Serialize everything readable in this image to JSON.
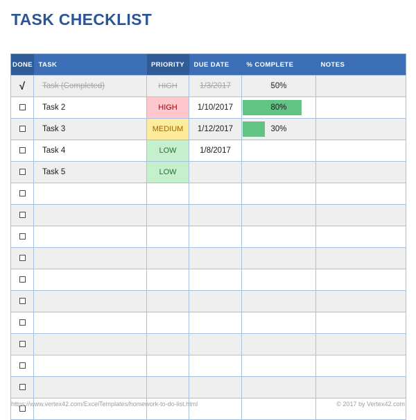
{
  "title": "TASK CHECKLIST",
  "table": {
    "columns": [
      {
        "key": "done",
        "label": "DONE"
      },
      {
        "key": "task",
        "label": "TASK"
      },
      {
        "key": "priority",
        "label": "PRIORITY"
      },
      {
        "key": "due",
        "label": "DUE DATE"
      },
      {
        "key": "pct",
        "label": "% COMPLETE"
      },
      {
        "key": "notes",
        "label": "NOTES"
      }
    ],
    "check_glyph": "√",
    "rows": [
      {
        "done": true,
        "task": "Task (Completed)",
        "priority": "HIGH",
        "due": "1/3/2017",
        "pct": "50%",
        "pct_value": 50,
        "notes": "",
        "completed": true,
        "bar": false
      },
      {
        "done": false,
        "task": "Task 2",
        "priority": "HIGH",
        "due": "1/10/2017",
        "pct": "80%",
        "pct_value": 80,
        "notes": "",
        "completed": false,
        "bar": true
      },
      {
        "done": false,
        "task": "Task 3",
        "priority": "MEDIUM",
        "due": "1/12/2017",
        "pct": "30%",
        "pct_value": 30,
        "notes": "",
        "completed": false,
        "bar": true
      },
      {
        "done": false,
        "task": "Task 4",
        "priority": "LOW",
        "due": "1/8/2017",
        "pct": "",
        "pct_value": 0,
        "notes": "",
        "completed": false,
        "bar": false
      },
      {
        "done": false,
        "task": "Task 5",
        "priority": "LOW",
        "due": "",
        "pct": "",
        "pct_value": 0,
        "notes": "",
        "completed": false,
        "bar": false
      },
      {
        "done": false,
        "task": "",
        "priority": "",
        "due": "",
        "pct": "",
        "pct_value": 0,
        "notes": "",
        "completed": false,
        "bar": false
      },
      {
        "done": false,
        "task": "",
        "priority": "",
        "due": "",
        "pct": "",
        "pct_value": 0,
        "notes": "",
        "completed": false,
        "bar": false
      },
      {
        "done": false,
        "task": "",
        "priority": "",
        "due": "",
        "pct": "",
        "pct_value": 0,
        "notes": "",
        "completed": false,
        "bar": false
      },
      {
        "done": false,
        "task": "",
        "priority": "",
        "due": "",
        "pct": "",
        "pct_value": 0,
        "notes": "",
        "completed": false,
        "bar": false
      },
      {
        "done": false,
        "task": "",
        "priority": "",
        "due": "",
        "pct": "",
        "pct_value": 0,
        "notes": "",
        "completed": false,
        "bar": false
      },
      {
        "done": false,
        "task": "",
        "priority": "",
        "due": "",
        "pct": "",
        "pct_value": 0,
        "notes": "",
        "completed": false,
        "bar": false
      },
      {
        "done": false,
        "task": "",
        "priority": "",
        "due": "",
        "pct": "",
        "pct_value": 0,
        "notes": "",
        "completed": false,
        "bar": false
      },
      {
        "done": false,
        "task": "",
        "priority": "",
        "due": "",
        "pct": "",
        "pct_value": 0,
        "notes": "",
        "completed": false,
        "bar": false
      },
      {
        "done": false,
        "task": "",
        "priority": "",
        "due": "",
        "pct": "",
        "pct_value": 0,
        "notes": "",
        "completed": false,
        "bar": false
      },
      {
        "done": false,
        "task": "",
        "priority": "",
        "due": "",
        "pct": "",
        "pct_value": 0,
        "notes": "",
        "completed": false,
        "bar": false
      },
      {
        "done": false,
        "task": "",
        "priority": "",
        "due": "",
        "pct": "",
        "pct_value": 0,
        "notes": "",
        "completed": false,
        "bar": false
      }
    ]
  },
  "footer": {
    "url": "https://www.vertex42.com/ExcelTemplates/homework-to-do-list.html",
    "copyright": "© 2017 by Vertex42.com"
  },
  "colors": {
    "title": "#2a5699",
    "header_bg": "#3b6eb4",
    "header_bg_dark": "#2f5b96",
    "grid": "#a8c0e0",
    "row_alt": "#efefef",
    "priority_high_bg": "#ffc7ce",
    "priority_high_text": "#9c0006",
    "priority_medium_bg": "#ffeb9c",
    "priority_medium_text": "#9c6500",
    "priority_low_bg": "#c6efce",
    "priority_low_text": "#256f33",
    "databar": "#63c384",
    "completed_text": "#a6a6a6",
    "footer_text": "#9d9d9d"
  }
}
